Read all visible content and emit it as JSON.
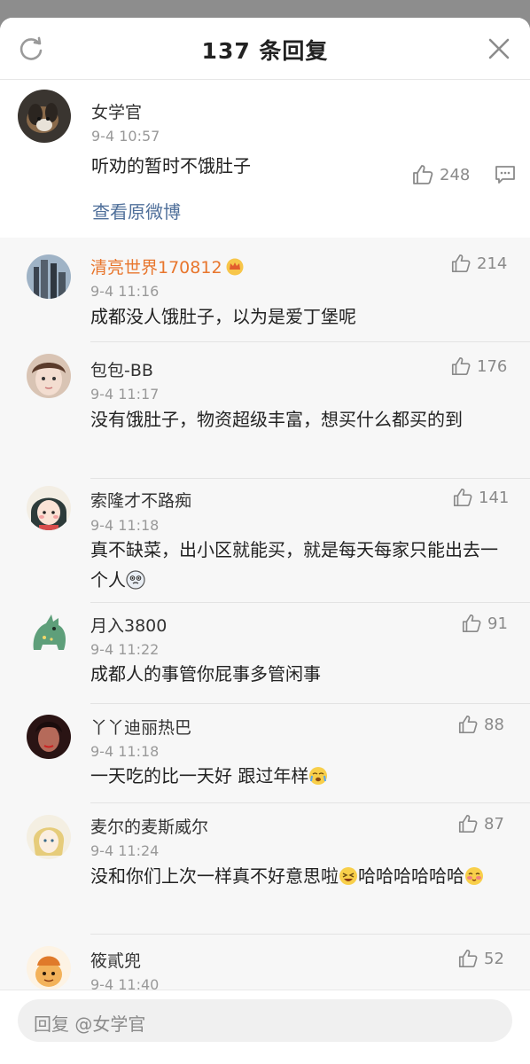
{
  "header": {
    "title": "137 条回复"
  },
  "root": {
    "name": "女学官",
    "time": "9-4 10:57",
    "text": "听劝的暂时不饿肚子",
    "likes": "248",
    "link": "查看原微博"
  },
  "replies": [
    {
      "name": "清亮世界170812",
      "name_color": "#e8762d",
      "time": "9-4 11:16",
      "text": "成都没人饿肚子，以为是爱丁堡呢",
      "likes": "214"
    },
    {
      "name": "包包-BB",
      "time": "9-4 11:17",
      "text": "没有饿肚子，物资超级丰富，想买什么都买的到",
      "likes": "176"
    },
    {
      "name": "索隆才不路痴",
      "time": "9-4 11:18",
      "text": "真不缺菜，出小区就能买，就是每天每家只能出去一个人",
      "likes": "141"
    },
    {
      "name": "月入3800",
      "time": "9-4 11:22",
      "text": "成都人的事管你屁事多管闲事",
      "likes": "91"
    },
    {
      "name": "丫丫迪丽热巴",
      "time": "9-4 11:18",
      "text": "一天吃的比一天好 跟过年样",
      "likes": "88"
    },
    {
      "name": "麦尔的麦斯威尔",
      "time": "9-4 11:24",
      "text_a": "没和你们上次一样真不好意思啦",
      "text_b": "哈哈哈哈哈哈",
      "likes": "87"
    },
    {
      "name": "筱貳兜",
      "time": "9-4 11:40",
      "likes": "52"
    }
  ],
  "composer": {
    "placeholder": "回复 @女学官"
  }
}
